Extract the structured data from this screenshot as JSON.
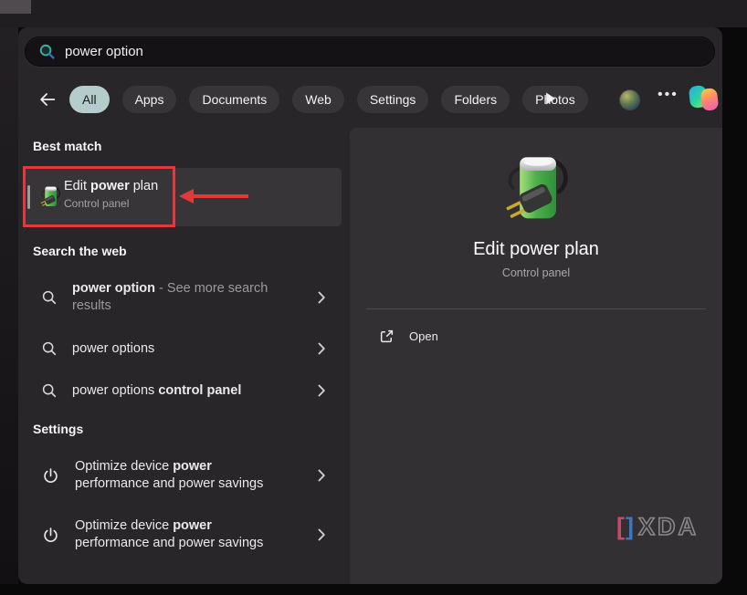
{
  "search_bar": {
    "value": "power option"
  },
  "tab_bar": {
    "tabs": [
      {
        "label": "All"
      },
      {
        "label": "Apps"
      },
      {
        "label": "Documents"
      },
      {
        "label": "Web"
      },
      {
        "label": "Settings"
      },
      {
        "label": "Folders"
      },
      {
        "label": "Photos"
      }
    ],
    "selected_tab": "All",
    "ellipsis": "•••"
  },
  "sections": {
    "best_match": {
      "header": "Best match",
      "item": {
        "title_pre": "Edit ",
        "title_bold": "power",
        "title_post": " plan",
        "subtitle": "Control panel"
      }
    },
    "web": {
      "header": "Search the web",
      "rows": [
        {
          "lead_bold": "power option",
          "muted": " - See more search results"
        },
        {
          "text": "power options"
        },
        {
          "text": "power options ",
          "tail_bold": "control panel"
        }
      ]
    },
    "settings": {
      "header": "Settings",
      "rows": [
        {
          "pre": "Optimize device ",
          "bold": "power",
          "post": " performance and power savings"
        },
        {
          "pre": "Optimize device ",
          "bold": "power",
          "post": " performance and power savings"
        }
      ]
    }
  },
  "detail_panel": {
    "title": "Edit power plan",
    "subtitle": "Control panel",
    "open_label": "Open"
  },
  "watermark": {
    "bracket_left": "[",
    "bracket_right": "]",
    "name": "XDA"
  },
  "colors": {
    "annotation_red": "#e23a3a",
    "selected_tab_bg": "#b4cccc",
    "battery_green": "#4db04a",
    "window_bg": "#292629",
    "right_panel_bg": "#333033"
  }
}
